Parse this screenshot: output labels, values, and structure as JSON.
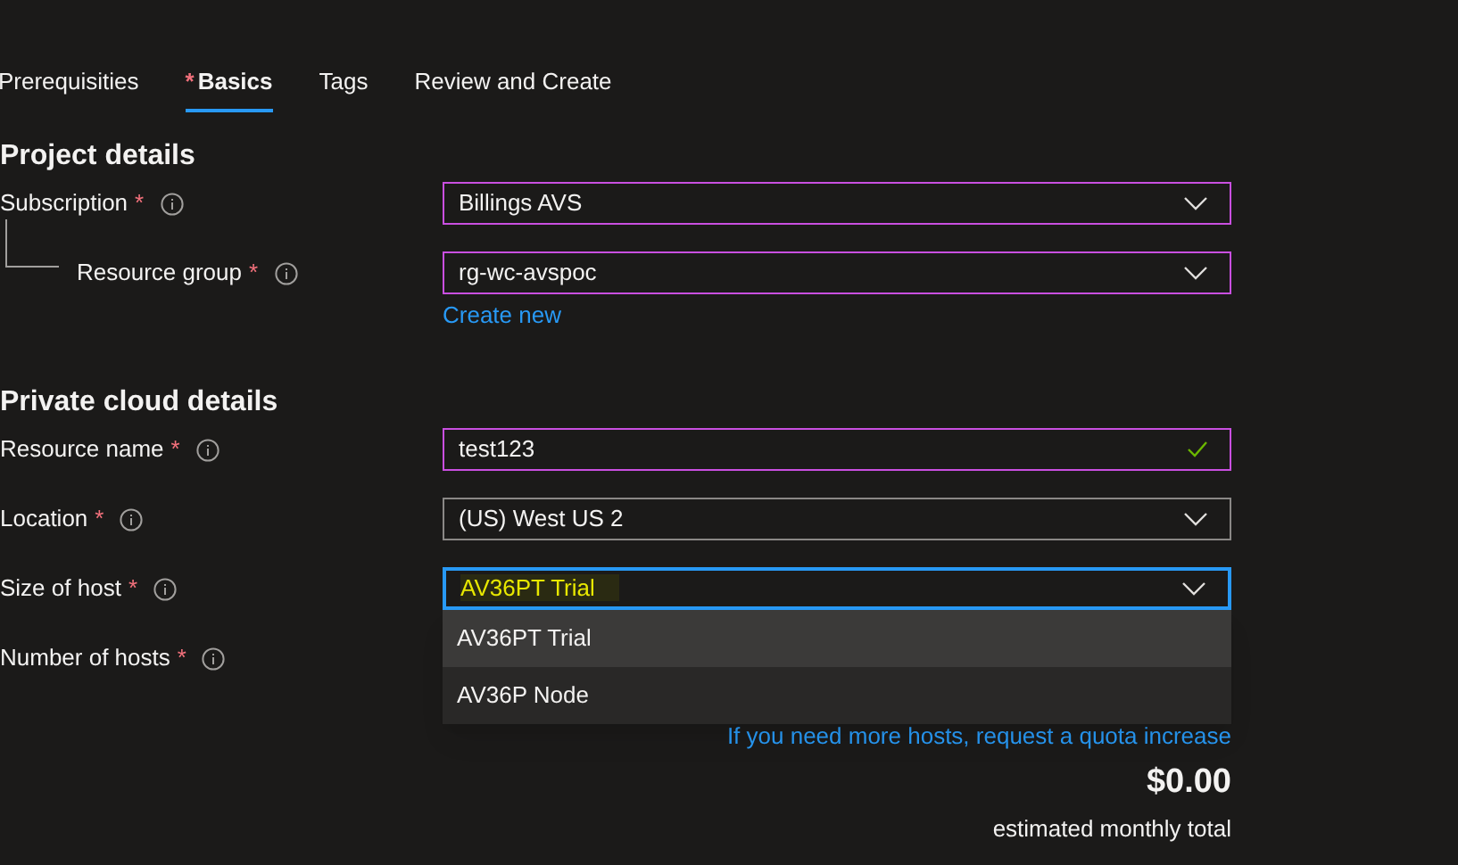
{
  "tabs": [
    {
      "label": "Prerequisities",
      "selected": false
    },
    {
      "label": "Basics",
      "required_mark": "*",
      "selected": true
    },
    {
      "label": "Tags",
      "selected": false
    },
    {
      "label": "Review and Create",
      "selected": false
    }
  ],
  "sections": [
    {
      "heading": "Project details",
      "rows": [
        {
          "label": "Subscription",
          "required_mark": "*",
          "nested": false,
          "field": {
            "kind": "select",
            "value": "Billings AVS",
            "flagged": true,
            "focused": false
          }
        },
        {
          "label": "Resource group",
          "required_mark": "*",
          "nested": true,
          "field": {
            "kind": "select",
            "value": "rg-wc-avspoc",
            "flagged": true,
            "focused": false
          },
          "link": "Create new"
        }
      ]
    },
    {
      "heading": "Private cloud details",
      "rows": [
        {
          "label": "Resource name",
          "required_mark": "*",
          "nested": false,
          "field": {
            "kind": "text",
            "value": "test123",
            "flagged": true,
            "focused": false,
            "valid": true
          }
        },
        {
          "label": "Location",
          "required_mark": "*",
          "nested": false,
          "field": {
            "kind": "select",
            "value": "(US) West US 2",
            "flagged": false,
            "focused": false
          }
        },
        {
          "label": "Size of host",
          "required_mark": "*",
          "nested": false,
          "field": {
            "kind": "select",
            "value": "AV36PT Trial",
            "focused": true,
            "highlighted": true
          },
          "options": [
            {
              "label": "AV36PT Trial",
              "selected": true
            },
            {
              "label": "AV36P Node",
              "selected": false
            }
          ]
        },
        {
          "label": "Number of hosts",
          "required_mark": "*",
          "nested": false
        }
      ]
    }
  ],
  "quota_link": "If you need more hosts, request a quota increase",
  "price": "$0.00",
  "price_caption": "estimated monthly total"
}
